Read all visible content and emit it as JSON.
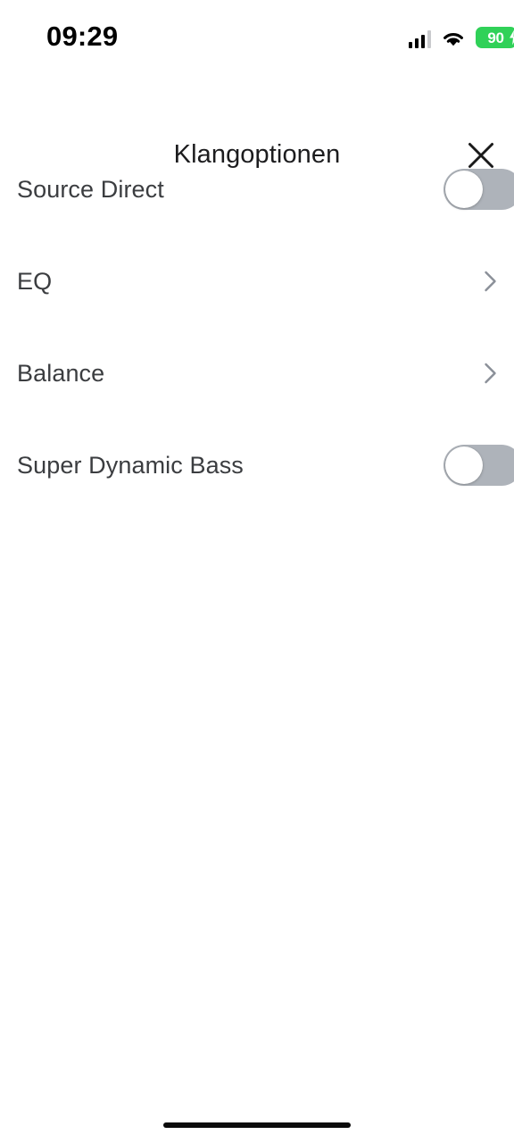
{
  "status_bar": {
    "time": "09:29",
    "signal_icon": "cellular-signal-icon",
    "signal_bars_filled": 3,
    "signal_bars_total": 4,
    "wifi_icon": "wifi-icon",
    "battery": {
      "percent_label": "90",
      "charging": true,
      "icon": "battery-charging-icon",
      "color": "#30d158"
    }
  },
  "header": {
    "title": "Klangoptionen",
    "close_icon": "close-icon"
  },
  "settings": {
    "rows": [
      {
        "label": "Source Direct",
        "accessory": "toggle",
        "value": "off",
        "name": "source-direct"
      },
      {
        "label": "EQ",
        "accessory": "chevron",
        "value": "",
        "name": "eq"
      },
      {
        "label": "Balance",
        "accessory": "chevron",
        "value": "",
        "name": "balance"
      },
      {
        "label": "Super Dynamic Bass",
        "accessory": "toggle",
        "value": "off",
        "name": "super-dynamic-bass"
      }
    ]
  },
  "home_indicator": {
    "label": "home-indicator"
  },
  "colors": {
    "background": "#ffffff",
    "text_primary": "#1c1c1e",
    "text_row": "#3b3d40",
    "toggle_off_track": "#aeb3ba",
    "toggle_on_track": "#30d158",
    "chevron": "#8a8f98",
    "battery_green": "#30d158"
  }
}
